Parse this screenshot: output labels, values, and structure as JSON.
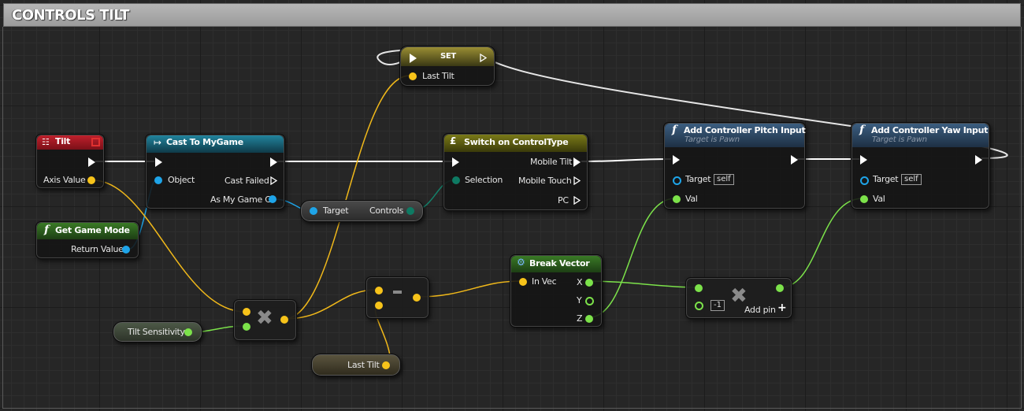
{
  "comment": {
    "title": "CONTROLS TILT"
  },
  "nodes": {
    "tilt": {
      "title": "Tilt",
      "axis_value": "Axis Value"
    },
    "cast": {
      "title": "Cast To MyGame",
      "object": "Object",
      "cast_failed": "Cast Failed",
      "as_my_game": "As My Game C"
    },
    "get_game_mode": {
      "title": "Get Game Mode",
      "return_value": "Return Value"
    },
    "target_controls": {
      "target": "Target",
      "controls": "Controls"
    },
    "set": {
      "title": "SET",
      "last_tilt": "Last Tilt"
    },
    "switch": {
      "title": "Switch on ControlType",
      "selection": "Selection",
      "mobile_tilt": "Mobile Tilt",
      "mobile_touch": "Mobile Touch",
      "pc": "PC"
    },
    "pitch": {
      "title": "Add Controller Pitch Input",
      "subtitle": "Target is Pawn",
      "target": "Target",
      "self": "self",
      "val": "Val"
    },
    "yaw": {
      "title": "Add Controller Yaw Input",
      "subtitle": "Target is Pawn",
      "target": "Target",
      "self": "self",
      "val": "Val"
    },
    "break_vector": {
      "title": "Break Vector",
      "in_vec": "In Vec",
      "x": "X",
      "y": "Y",
      "z": "Z"
    },
    "multiply2": {
      "value": "-1",
      "add_pin": "Add pin"
    },
    "tilt_sensitivity": {
      "label": "Tilt Sensitivity"
    },
    "last_tilt_get": {
      "label": "Last Tilt"
    }
  },
  "colors": {
    "exec": "#ffffff",
    "vector": "#f7c31a",
    "float": "#7ce24a",
    "object": "#1ea4e8",
    "enum": "#0e7a63",
    "tilt_header": "#a31621",
    "cast_header": "#1a6a80",
    "func_header": "#2e4a66",
    "pure_header": "#2c5a1e",
    "switch_header": "#6a6a10",
    "set_header": "#78702a"
  }
}
